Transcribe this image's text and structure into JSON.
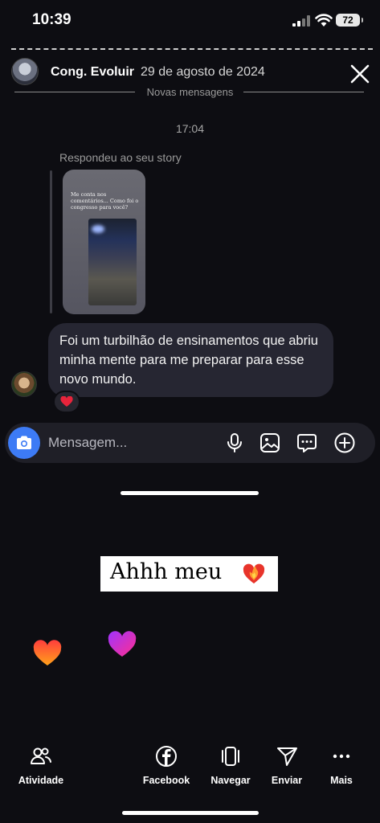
{
  "status_bar": {
    "time": "10:39",
    "battery": "72"
  },
  "header": {
    "account_name": "Cong. Evoluir",
    "date": "29 de agosto de 2024",
    "new_messages_label": "Novas mensagens"
  },
  "chat": {
    "time": "17:04",
    "replied_label": "Respondeu ao seu story",
    "story_preview_text": "Me conta nos comentários... Como foi o congresso para você?",
    "message": "Foi um turbilhão de ensinamentos que abriu minha mente para me preparar para esse novo mundo.",
    "reaction_icon": "red-heart"
  },
  "composer": {
    "placeholder": "Mensagem...",
    "icons": [
      "camera-icon",
      "microphone-icon",
      "image-icon",
      "sticker-chat-icon",
      "plus-icon"
    ],
    "accent_color": "#3d7bf5"
  },
  "story": {
    "sticker_text": "Ahhh meu",
    "sticker_emoji": "heart-on-fire"
  },
  "bottom_nav": {
    "items": [
      {
        "label": "Atividade",
        "icon": "activity-icon"
      },
      {
        "label": "Facebook",
        "icon": "facebook-icon"
      },
      {
        "label": "Navegar",
        "icon": "browse-icon"
      },
      {
        "label": "Enviar",
        "icon": "send-icon"
      },
      {
        "label": "Mais",
        "icon": "more-icon"
      }
    ]
  }
}
